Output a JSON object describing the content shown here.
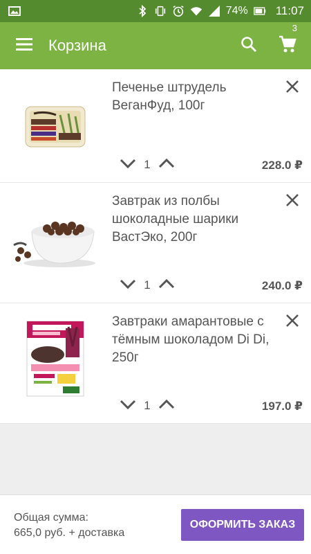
{
  "status_bar": {
    "battery": "74%",
    "time": "11:07",
    "icons": [
      "image-icon",
      "bluetooth-icon",
      "vibrate-icon",
      "alarm-icon",
      "wifi-icon",
      "signal-icon",
      "battery-icon"
    ]
  },
  "app_bar": {
    "title": "Корзина",
    "cart_count": "3",
    "icons": [
      "menu-icon",
      "search-icon",
      "cart-icon"
    ],
    "color": "#7cb342"
  },
  "items": [
    {
      "name": "Печенье штрудель ВеганФуд, 100г",
      "qty": "1",
      "price": "228.0 ₽",
      "image": "strudel-cookies-box"
    },
    {
      "name": "Завтрак из полбы шоколадные шарики ВастЭко, 200г",
      "qty": "1",
      "price": "240.0 ₽",
      "image": "chocolate-balls-bowl"
    },
    {
      "name": "Завтраки амарантовые с тёмным шоколадом Di Di, 250г",
      "qty": "1",
      "price": "197.0 ₽",
      "image": "amaranth-breakfast-box"
    }
  ],
  "footer": {
    "total_label": "Общая сумма:",
    "total_value": "665,0 руб. + доставка",
    "order_button": "ОФОРМИТЬ ЗАКАЗ",
    "button_color": "#7e57c2"
  }
}
